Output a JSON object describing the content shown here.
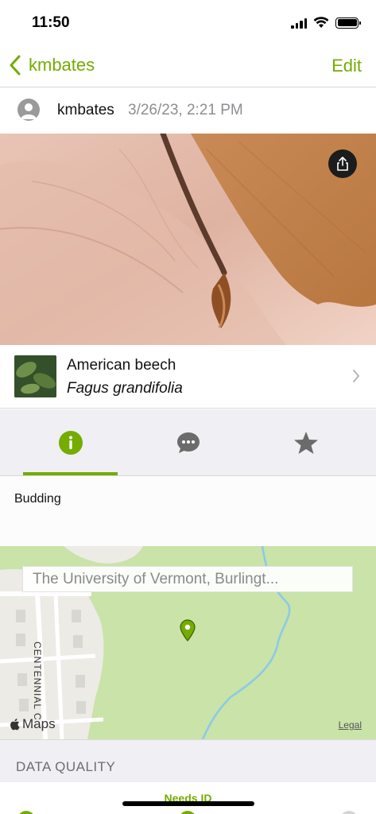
{
  "status_bar": {
    "time": "11:50"
  },
  "nav": {
    "back_label": "kmbates",
    "edit_label": "Edit"
  },
  "observation": {
    "user": "kmbates",
    "date": "3/26/23, 2:21 PM"
  },
  "taxon": {
    "common_name": "American beech",
    "scientific_name": "Fagus grandifolia"
  },
  "tabs": [
    {
      "name": "info",
      "icon": "info-icon",
      "active": true
    },
    {
      "name": "activity",
      "icon": "speech-bubble-icon",
      "active": false
    },
    {
      "name": "favorites",
      "icon": "star-icon",
      "active": false
    }
  ],
  "annotation": {
    "text": "Budding"
  },
  "map": {
    "location": "The University of Vermont, Burlingt...",
    "street": "CENTENNIAL C",
    "maps_label": "Maps",
    "legal_label": "Legal"
  },
  "data_quality": {
    "title": "DATA QUALITY",
    "status": "Needs ID"
  },
  "colors": {
    "accent": "#74ac00",
    "map_green": "#c9e3a8",
    "tab_background": "#efeff4"
  }
}
